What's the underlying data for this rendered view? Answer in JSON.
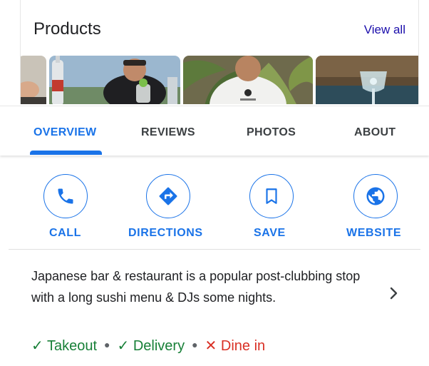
{
  "products": {
    "title": "Products",
    "view_all": "View all"
  },
  "tabs": [
    {
      "label": "OVERVIEW",
      "active": true
    },
    {
      "label": "REVIEWS",
      "active": false
    },
    {
      "label": "PHOTOS",
      "active": false
    },
    {
      "label": "ABOUT",
      "active": false
    }
  ],
  "actions": [
    {
      "label": "CALL",
      "icon": "phone-icon"
    },
    {
      "label": "DIRECTIONS",
      "icon": "directions-icon"
    },
    {
      "label": "SAVE",
      "icon": "bookmark-icon"
    },
    {
      "label": "WEBSITE",
      "icon": "globe-icon"
    }
  ],
  "description": "Japanese bar & restaurant is a popular post-clubbing stop with a long sushi menu & DJs some nights.",
  "services": [
    {
      "mark": "✓",
      "label": "Takeout",
      "available": true
    },
    {
      "mark": "✓",
      "label": "Delivery",
      "available": true
    },
    {
      "mark": "✕",
      "label": "Dine in",
      "available": false
    }
  ],
  "colors": {
    "accent": "#1a73e8",
    "available": "#188038",
    "unavailable": "#d93025"
  }
}
